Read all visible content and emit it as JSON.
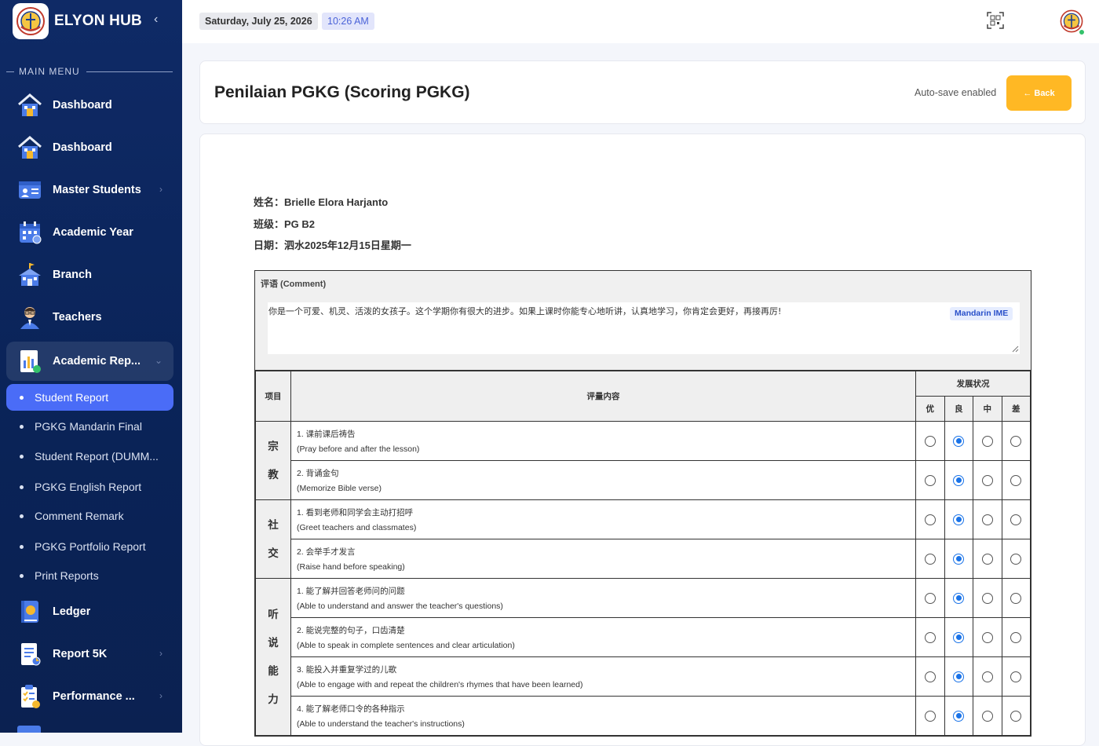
{
  "brand": {
    "name": "ELYON HUB",
    "collapse_glyph": "‹"
  },
  "menu_heading": "MAIN MENU",
  "nav": [
    {
      "label": "Dashboard",
      "icon": "home-icon"
    },
    {
      "label": "Dashboard",
      "icon": "home-icon"
    },
    {
      "label": "Master Students",
      "icon": "student-card-icon",
      "chevron": "›"
    },
    {
      "label": "Academic Year",
      "icon": "calendar-icon"
    },
    {
      "label": "Branch",
      "icon": "school-building-icon"
    },
    {
      "label": "Teachers",
      "icon": "teacher-icon"
    },
    {
      "label": "Academic Rep...",
      "icon": "report-chart-icon",
      "chevron": "⌄"
    }
  ],
  "submenu": [
    {
      "label": "Student Report"
    },
    {
      "label": "PGKG Mandarin Final"
    },
    {
      "label": "Student Report (DUMM..."
    },
    {
      "label": "PGKG English Report"
    },
    {
      "label": "Comment Remark"
    },
    {
      "label": "PGKG Portfolio Report"
    },
    {
      "label": "Print Reports"
    }
  ],
  "nav_bottom": [
    {
      "label": "Ledger",
      "icon": "ledger-book-icon"
    },
    {
      "label": "Report 5K",
      "icon": "document-report-icon",
      "chevron": "›"
    },
    {
      "label": "Performance ...",
      "icon": "clipboard-performance-icon",
      "chevron": "›"
    }
  ],
  "topbar": {
    "date": "Saturday, July 25, 2026",
    "time": "10:26 AM"
  },
  "header": {
    "title": "Penilaian PGKG (Scoring PGKG)",
    "autosave": "Auto-save enabled",
    "back_label": "← Back"
  },
  "student": {
    "name_line": "姓名：Brielle Elora Harjanto",
    "class_line": "班级：PG B2",
    "date_line": "日期：泗水2025年12月15日星期一"
  },
  "comment": {
    "label": "评语 (Comment)",
    "text": "你是一个可爱、机灵、活泼的女孩子。这个学期你有很大的进步。如果上课时你能专心地听讲，认真地学习，你肯定会更好，再接再厉!",
    "ime_badge": "Mandarin IME"
  },
  "table": {
    "col_category": "项目",
    "col_content": "评量内容",
    "col_status": "发展状况",
    "levels": [
      "优",
      "良",
      "中",
      "差"
    ],
    "groups": [
      {
        "chars": [
          "宗",
          "教"
        ],
        "items": [
          {
            "zh": "1. 课前课后祷告",
            "en": "(Pray before and after the lesson)",
            "selected": 1
          },
          {
            "zh": "2. 背诵金句",
            "en": "(Memorize Bible verse)",
            "selected": 1
          }
        ]
      },
      {
        "chars": [
          "社",
          "交"
        ],
        "items": [
          {
            "zh": "1. 看到老师和同学会主动打招呼",
            "en": "(Greet teachers and classmates)",
            "selected": 1
          },
          {
            "zh": "2. 会举手才发言",
            "en": "(Raise hand before speaking)",
            "selected": 1
          }
        ]
      },
      {
        "chars": [
          "听",
          "说",
          "能",
          "力"
        ],
        "items": [
          {
            "zh": "1. 能了解并回答老师问的问题",
            "en": "(Able to understand and answer the teacher's questions)",
            "selected": 1
          },
          {
            "zh": "2. 能说完整的句子，口齿清楚",
            "en": "(Able to speak in complete sentences and clear articulation)",
            "selected": 1
          },
          {
            "zh": "3. 能投入并重复学过的儿歌",
            "en": "(Able to engage with and repeat the children's rhymes that have been learned)",
            "selected": 1
          },
          {
            "zh": "4. 能了解老师口令的各种指示",
            "en": "(Able to understand the teacher's instructions)",
            "selected": 1
          }
        ]
      }
    ]
  }
}
